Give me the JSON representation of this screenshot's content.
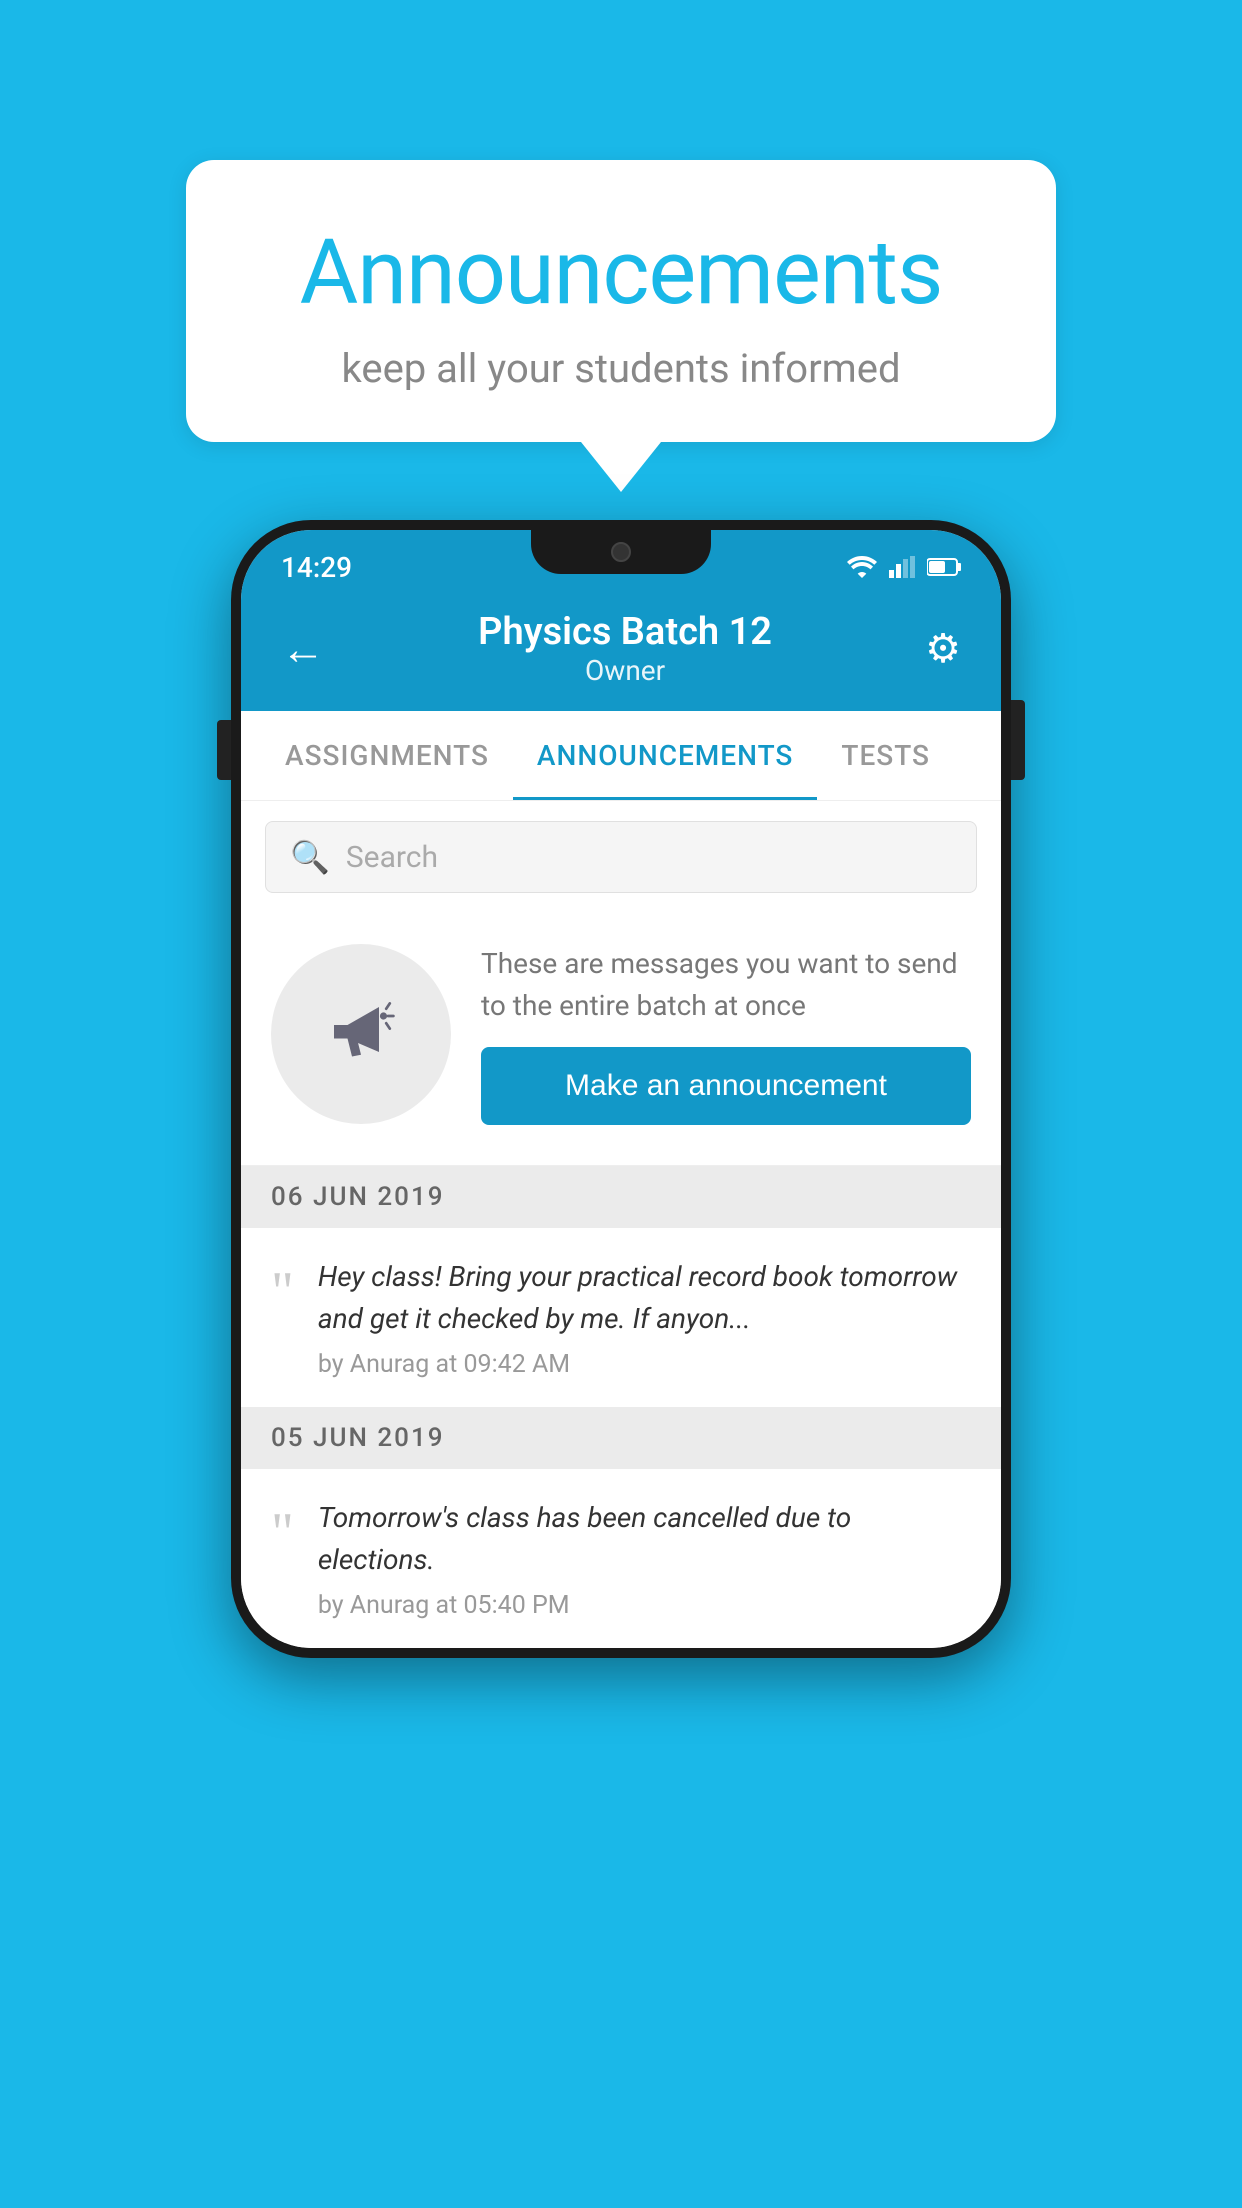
{
  "page": {
    "background_color": "#1ab8e8"
  },
  "speech_bubble": {
    "title": "Announcements",
    "subtitle": "keep all your students informed"
  },
  "status_bar": {
    "time": "14:29"
  },
  "app_header": {
    "back_label": "←",
    "title": "Physics Batch 12",
    "subtitle": "Owner",
    "gear_label": "⚙"
  },
  "tabs": [
    {
      "label": "ASSIGNMENTS",
      "active": false
    },
    {
      "label": "ANNOUNCEMENTS",
      "active": true
    },
    {
      "label": "TESTS",
      "active": false
    }
  ],
  "search": {
    "placeholder": "Search"
  },
  "promo": {
    "description": "These are messages you want to send to the entire batch at once",
    "button_label": "Make an announcement"
  },
  "announcements": [
    {
      "date": "06  JUN  2019",
      "text": "Hey class! Bring your practical record book tomorrow and get it checked by me. If anyon...",
      "meta": "by Anurag at 09:42 AM"
    },
    {
      "date": "05  JUN  2019",
      "text": "Tomorrow's class has been cancelled due to elections.",
      "meta": "by Anurag at 05:40 PM"
    }
  ]
}
